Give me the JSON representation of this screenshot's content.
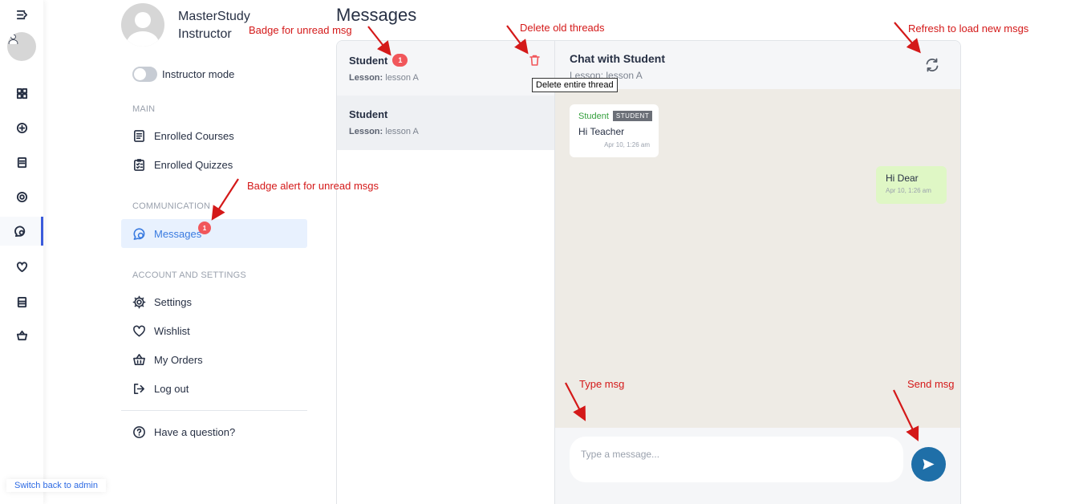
{
  "profile": {
    "name": "MasterStudy Instructor"
  },
  "toggle": {
    "label": "Instructor mode"
  },
  "sections": {
    "main": "MAIN",
    "communication": "COMMUNICATION",
    "account": "ACCOUNT AND SETTINGS"
  },
  "nav": {
    "enrolled_courses": "Enrolled Courses",
    "enrolled_quizzes": "Enrolled Quizzes",
    "messages": "Messages",
    "messages_badge": "1",
    "settings": "Settings",
    "wishlist": "Wishlist",
    "my_orders": "My Orders",
    "log_out": "Log out",
    "have_question": "Have a question?"
  },
  "switch_admin": "Switch back to admin",
  "page_title": "Messages",
  "threads": [
    {
      "name": "Student",
      "badge": "1",
      "lesson_label": "Lesson:",
      "lesson": "lesson A"
    },
    {
      "name": "Student",
      "lesson_label": "Lesson:",
      "lesson": "lesson A"
    }
  ],
  "tooltip": "Delete entire thread",
  "chat": {
    "title": "Chat with Student",
    "lesson": "Lesson: lesson A",
    "incoming": {
      "sender": "Student",
      "role": "STUDENT",
      "text": "Hi Teacher",
      "time": "Apr 10, 1:26 am"
    },
    "outgoing": {
      "text": "Hi Dear",
      "time": "Apr 10, 1:26 am"
    },
    "input_placeholder": "Type a message..."
  },
  "annotations": {
    "unread_badge": "Badge for unread msg",
    "delete_threads": "Delete old threads",
    "refresh": "Refresh to load new msgs",
    "badge_alert": "Badge alert for unread msgs",
    "type_msg": "Type msg",
    "send_msg": "Send msg"
  },
  "colors": {
    "accent": "#3a7be0",
    "badge": "#f1575b",
    "send_button": "#1f6fa8",
    "chat_background": "#eeebe5",
    "outgoing_bubble": "#dff7c5",
    "annotation": "#d41919"
  }
}
